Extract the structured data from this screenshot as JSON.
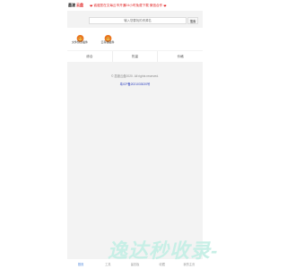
{
  "header": {
    "brand": "墨渡",
    "brand_accent": "云盘",
    "announcement": "诚邀您在文每云市开通24小时免费下载 微信合作"
  },
  "search": {
    "placeholder": "输入您要找的资源名",
    "button_label": "搜索"
  },
  "apps": [
    {
      "label": "文件预览插件",
      "icon": "orange-app-icon"
    },
    {
      "label": "云存储插件",
      "icon": "orange-app-icon"
    }
  ],
  "tabs": [
    "综合",
    "热量",
    "价格"
  ],
  "footer": {
    "copyright": "© 墨渡云盘2020. All rights reserved.",
    "icp": "粤ICP备2021033020号"
  },
  "watermark": "逸达秒收录-",
  "nav": {
    "items": [
      "首页",
      "工具",
      "留言板",
      "收藏",
      "我的主页"
    ],
    "active_index": 0
  },
  "colors": {
    "accent_red": "#e02020",
    "link_blue": "#2b3fbf",
    "nav_active": "#3b7bd9",
    "watermark": "#c7efe6"
  }
}
